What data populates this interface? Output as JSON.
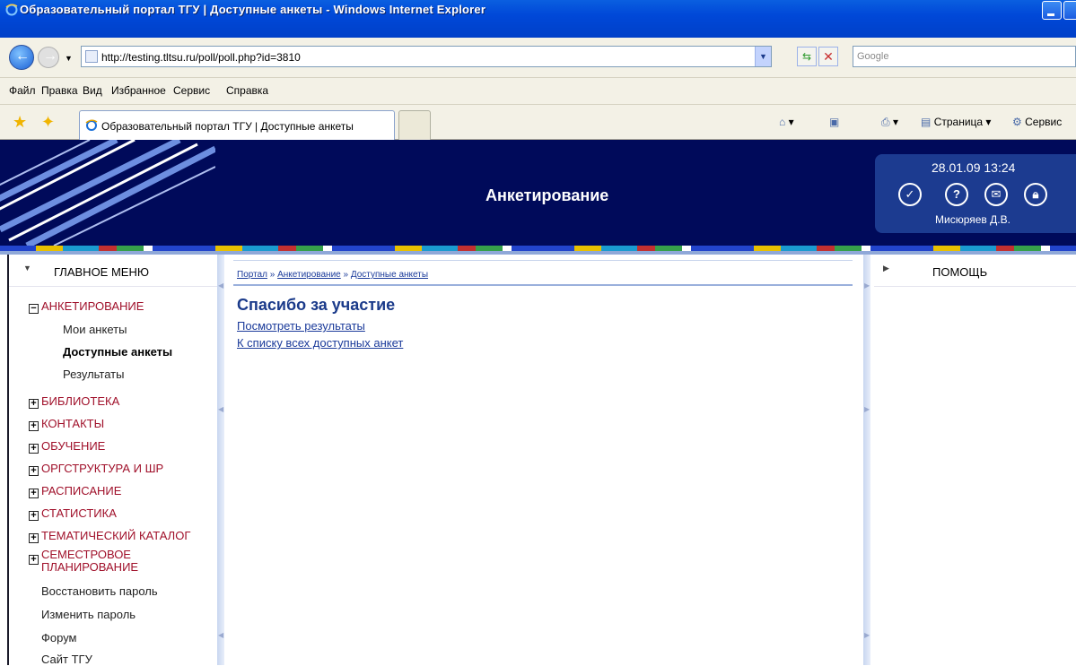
{
  "window": {
    "title": "Образовательный портал ТГУ | Доступные анкеты - Windows Internet Explorer"
  },
  "address_bar": {
    "url": "http://testing.tltsu.ru/poll/poll.php?id=3810",
    "search_placeholder": "Google"
  },
  "menu": [
    "Файл",
    "Правка",
    "Вид",
    "Избранное",
    "Сервис",
    "Справка"
  ],
  "tab": {
    "label": "Образовательный портал ТГУ | Доступные анкеты"
  },
  "command_bar": {
    "page_label": "Страница",
    "tools_label": "Сервис"
  },
  "header": {
    "title": "Анкетирование",
    "datetime": "28.01.09 13:24",
    "user": "Мисюряев Д.В.",
    "icons": [
      "check-icon",
      "help-icon",
      "mail-icon",
      "lock-icon"
    ]
  },
  "left_menu": {
    "title": "ГЛАВНОЕ МЕНЮ",
    "sections": [
      {
        "label": "АНКЕТИРОВАНИЕ",
        "expanded": true
      },
      {
        "label": "БИБЛИОТЕКА",
        "expanded": false
      },
      {
        "label": "КОНТАКТЫ",
        "expanded": false
      },
      {
        "label": "ОБУЧЕНИЕ",
        "expanded": false
      },
      {
        "label": "ОРГСТРУКТУРА И ШР",
        "expanded": false
      },
      {
        "label": "РАСПИСАНИЕ",
        "expanded": false
      },
      {
        "label": "СТАТИСТИКА",
        "expanded": false
      },
      {
        "label": "ТЕМАТИЧЕСКИЙ КАТАЛОГ",
        "expanded": false
      },
      {
        "label": "СЕМЕСТРОВОЕ",
        "label2": "ПЛАНИРОВАНИЕ",
        "expanded": false
      }
    ],
    "subitems": [
      {
        "label": "Мои анкеты",
        "active": false
      },
      {
        "label": "Доступные анкеты",
        "active": true
      },
      {
        "label": "Результаты",
        "active": false
      }
    ],
    "links": [
      "Восстановить пароль",
      "Изменить пароль",
      "Форум",
      "Сайт ТГУ"
    ]
  },
  "content": {
    "breadcrumb": [
      "Портал",
      "Анкетирование",
      "Доступные анкеты"
    ],
    "breadcrumb_sep": "»",
    "title": "Спасибо за участие",
    "links": [
      "Посмотреть результаты",
      "К списку всех доступных анкет"
    ]
  },
  "right_panel": {
    "title": "ПОМОЩЬ"
  },
  "colors": {
    "banner_bg": "#000a5a",
    "menu_section": "#a0102a",
    "link": "#1a3a9a",
    "title_blue": "#1a3a8a"
  }
}
